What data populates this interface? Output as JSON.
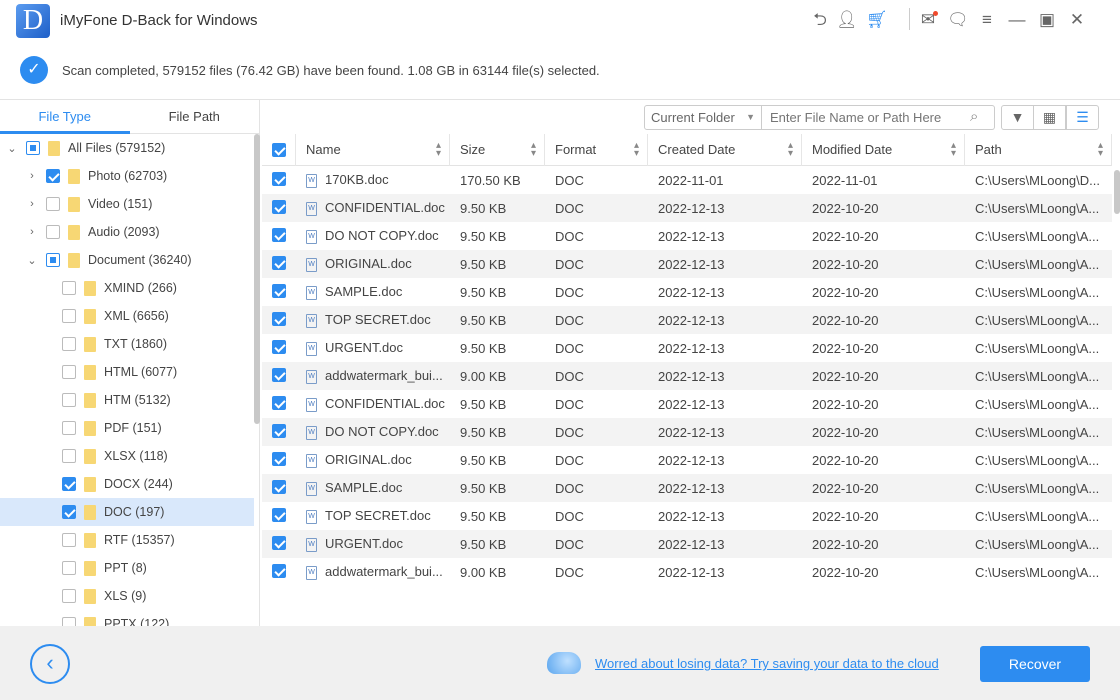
{
  "app": {
    "title": "iMyFone D-Back for Windows",
    "logo_letter": "D",
    "accent": "#2d8cf0"
  },
  "titlebar_icons": [
    "share-icon",
    "user-icon",
    "cart-icon",
    "mail-icon",
    "feedback-icon",
    "menu-icon",
    "minimize-icon",
    "maximize-icon",
    "close-icon"
  ],
  "status": {
    "text": "Scan completed, 579152 files (76.42 GB) have been found. 1.08 GB in 63144 file(s) selected."
  },
  "sidebar": {
    "tabs": [
      {
        "label": "File Type",
        "active": true
      },
      {
        "label": "File Path",
        "active": false
      }
    ],
    "tree": [
      {
        "label": "All Files (579152)",
        "level": 0,
        "caret": "open",
        "check": "part"
      },
      {
        "label": "Photo (62703)",
        "level": 1,
        "caret": "closed",
        "check": "on"
      },
      {
        "label": "Video (151)",
        "level": 1,
        "caret": "closed",
        "check": "off"
      },
      {
        "label": "Audio (2093)",
        "level": 1,
        "caret": "closed",
        "check": "off"
      },
      {
        "label": "Document (36240)",
        "level": 1,
        "caret": "open",
        "check": "part"
      },
      {
        "label": "XMIND (266)",
        "level": 2,
        "check": "off"
      },
      {
        "label": "XML (6656)",
        "level": 2,
        "check": "off"
      },
      {
        "label": "TXT (1860)",
        "level": 2,
        "check": "off"
      },
      {
        "label": "HTML (6077)",
        "level": 2,
        "check": "off"
      },
      {
        "label": "HTM (5132)",
        "level": 2,
        "check": "off"
      },
      {
        "label": "PDF (151)",
        "level": 2,
        "check": "off"
      },
      {
        "label": "XLSX (118)",
        "level": 2,
        "check": "off"
      },
      {
        "label": "DOCX (244)",
        "level": 2,
        "check": "on"
      },
      {
        "label": "DOC (197)",
        "level": 2,
        "check": "on",
        "selected": true
      },
      {
        "label": "RTF (15357)",
        "level": 2,
        "check": "off"
      },
      {
        "label": "PPT (8)",
        "level": 2,
        "check": "off"
      },
      {
        "label": "XLS (9)",
        "level": 2,
        "check": "off"
      },
      {
        "label": "PPTX (122)",
        "level": 2,
        "check": "off"
      }
    ]
  },
  "toolbar": {
    "scope": "Current Folder",
    "search_placeholder": "Enter File Name or Path Here"
  },
  "table": {
    "columns": [
      "Name",
      "Size",
      "Format",
      "Created Date",
      "Modified Date",
      "Path"
    ],
    "rows": [
      [
        "170KB.doc",
        "170.50 KB",
        "DOC",
        "2022-11-01",
        "2022-11-01",
        "C:\\Users\\MLoong\\D..."
      ],
      [
        "CONFIDENTIAL.doc",
        "9.50 KB",
        "DOC",
        "2022-12-13",
        "2022-10-20",
        "C:\\Users\\MLoong\\A..."
      ],
      [
        "DO NOT COPY.doc",
        "9.50 KB",
        "DOC",
        "2022-12-13",
        "2022-10-20",
        "C:\\Users\\MLoong\\A..."
      ],
      [
        "ORIGINAL.doc",
        "9.50 KB",
        "DOC",
        "2022-12-13",
        "2022-10-20",
        "C:\\Users\\MLoong\\A..."
      ],
      [
        "SAMPLE.doc",
        "9.50 KB",
        "DOC",
        "2022-12-13",
        "2022-10-20",
        "C:\\Users\\MLoong\\A..."
      ],
      [
        "TOP SECRET.doc",
        "9.50 KB",
        "DOC",
        "2022-12-13",
        "2022-10-20",
        "C:\\Users\\MLoong\\A..."
      ],
      [
        "URGENT.doc",
        "9.50 KB",
        "DOC",
        "2022-12-13",
        "2022-10-20",
        "C:\\Users\\MLoong\\A..."
      ],
      [
        "addwatermark_bui...",
        "9.00 KB",
        "DOC",
        "2022-12-13",
        "2022-10-20",
        "C:\\Users\\MLoong\\A..."
      ],
      [
        "CONFIDENTIAL.doc",
        "9.50 KB",
        "DOC",
        "2022-12-13",
        "2022-10-20",
        "C:\\Users\\MLoong\\A..."
      ],
      [
        "DO NOT COPY.doc",
        "9.50 KB",
        "DOC",
        "2022-12-13",
        "2022-10-20",
        "C:\\Users\\MLoong\\A..."
      ],
      [
        "ORIGINAL.doc",
        "9.50 KB",
        "DOC",
        "2022-12-13",
        "2022-10-20",
        "C:\\Users\\MLoong\\A..."
      ],
      [
        "SAMPLE.doc",
        "9.50 KB",
        "DOC",
        "2022-12-13",
        "2022-10-20",
        "C:\\Users\\MLoong\\A..."
      ],
      [
        "TOP SECRET.doc",
        "9.50 KB",
        "DOC",
        "2022-12-13",
        "2022-10-20",
        "C:\\Users\\MLoong\\A..."
      ],
      [
        "URGENT.doc",
        "9.50 KB",
        "DOC",
        "2022-12-13",
        "2022-10-20",
        "C:\\Users\\MLoong\\A..."
      ],
      [
        "addwatermark_bui...",
        "9.00 KB",
        "DOC",
        "2022-12-13",
        "2022-10-20",
        "C:\\Users\\MLoong\\A..."
      ]
    ]
  },
  "footer": {
    "cloud_link": "Worred about losing data? Try saving your data to the cloud",
    "recover_label": "Recover"
  }
}
